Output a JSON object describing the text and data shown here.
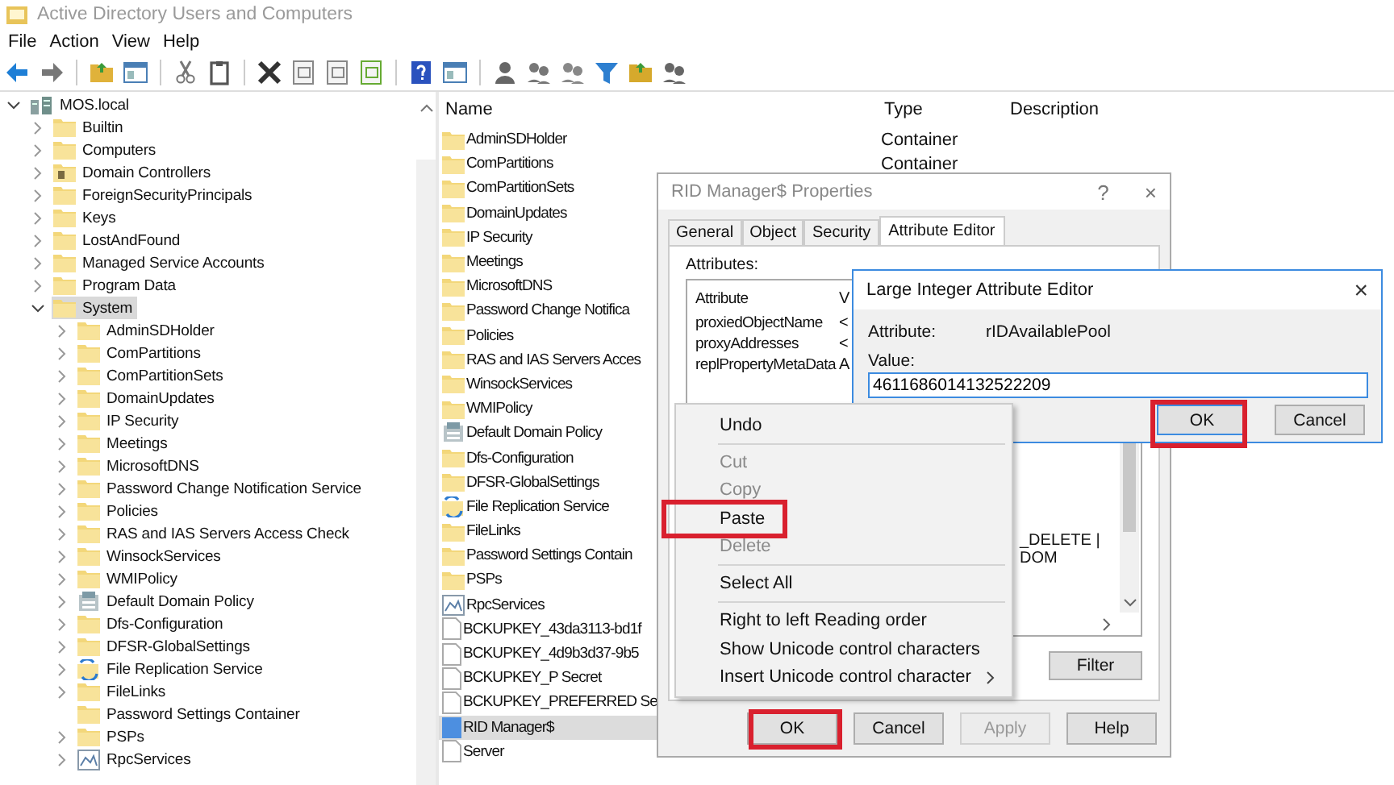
{
  "window": {
    "title": "Active Directory Users and Computers"
  },
  "menu": [
    "File",
    "Action",
    "View",
    "Help"
  ],
  "tree": [
    {
      "label": "MOS.local",
      "kind": "domain",
      "expandable": true,
      "expanded": true,
      "selected": false,
      "children": [
        {
          "label": "Builtin",
          "kind": "folder",
          "expandable": true,
          "expanded": false,
          "selected": false
        },
        {
          "label": "Computers",
          "kind": "folder",
          "expandable": true,
          "expanded": false,
          "selected": false
        },
        {
          "label": "Domain Controllers",
          "kind": "ou",
          "expandable": true,
          "expanded": false,
          "selected": false
        },
        {
          "label": "ForeignSecurityPrincipals",
          "kind": "folder",
          "expandable": true,
          "expanded": false,
          "selected": false
        },
        {
          "label": "Keys",
          "kind": "folder",
          "expandable": true,
          "expanded": false,
          "selected": false
        },
        {
          "label": "LostAndFound",
          "kind": "folder",
          "expandable": true,
          "expanded": false,
          "selected": false
        },
        {
          "label": "Managed Service Accounts",
          "kind": "folder",
          "expandable": true,
          "expanded": false,
          "selected": false
        },
        {
          "label": "Program Data",
          "kind": "folder",
          "expandable": true,
          "expanded": false,
          "selected": false
        },
        {
          "label": "System",
          "kind": "folder",
          "expandable": true,
          "expanded": true,
          "selected": true,
          "children": [
            {
              "label": "AdminSDHolder",
              "kind": "folder",
              "expandable": true,
              "expanded": false,
              "selected": false
            },
            {
              "label": "ComPartitions",
              "kind": "folder",
              "expandable": true,
              "expanded": false,
              "selected": false
            },
            {
              "label": "ComPartitionSets",
              "kind": "folder",
              "expandable": true,
              "expanded": false,
              "selected": false
            },
            {
              "label": "DomainUpdates",
              "kind": "folder",
              "expandable": true,
              "expanded": false,
              "selected": false
            },
            {
              "label": "IP Security",
              "kind": "folder",
              "expandable": true,
              "expanded": false,
              "selected": false
            },
            {
              "label": "Meetings",
              "kind": "folder",
              "expandable": true,
              "expanded": false,
              "selected": false
            },
            {
              "label": "MicrosoftDNS",
              "kind": "folder",
              "expandable": true,
              "expanded": false,
              "selected": false
            },
            {
              "label": "Password Change Notification Service",
              "kind": "folder",
              "expandable": true,
              "expanded": false,
              "selected": false
            },
            {
              "label": "Policies",
              "kind": "folder",
              "expandable": true,
              "expanded": false,
              "selected": false
            },
            {
              "label": "RAS and IAS Servers Access Check",
              "kind": "folder",
              "expandable": true,
              "expanded": false,
              "selected": false
            },
            {
              "label": "WinsockServices",
              "kind": "folder",
              "expandable": true,
              "expanded": false,
              "selected": false
            },
            {
              "label": "WMIPolicy",
              "kind": "folder",
              "expandable": true,
              "expanded": false,
              "selected": false
            },
            {
              "label": "Default Domain Policy",
              "kind": "policy",
              "expandable": true,
              "expanded": false,
              "selected": false
            },
            {
              "label": "Dfs-Configuration",
              "kind": "folder",
              "expandable": true,
              "expanded": false,
              "selected": false
            },
            {
              "label": "DFSR-GlobalSettings",
              "kind": "folder",
              "expandable": true,
              "expanded": false,
              "selected": false
            },
            {
              "label": "File Replication Service",
              "kind": "replication",
              "expandable": true,
              "expanded": false,
              "selected": false
            },
            {
              "label": "FileLinks",
              "kind": "folder",
              "expandable": true,
              "expanded": false,
              "selected": false
            },
            {
              "label": "Password Settings Container",
              "kind": "folder",
              "expandable": false,
              "selected": false
            },
            {
              "label": "PSPs",
              "kind": "folder",
              "expandable": true,
              "expanded": false,
              "selected": false
            },
            {
              "label": "RpcServices",
              "kind": "service",
              "expandable": true,
              "expanded": false,
              "selected": false
            }
          ]
        }
      ]
    }
  ],
  "list": {
    "columns": [
      "Name",
      "Type",
      "Description"
    ],
    "rows": [
      {
        "name": "AdminSDHolder",
        "kind": "folder",
        "type": "Container",
        "selected": false
      },
      {
        "name": "ComPartitions",
        "kind": "folder",
        "type": "Container",
        "selected": false
      },
      {
        "name": "ComPartitionSets",
        "kind": "folder",
        "selected": false
      },
      {
        "name": "DomainUpdates",
        "kind": "folder",
        "selected": false
      },
      {
        "name": "IP Security",
        "kind": "folder",
        "selected": false
      },
      {
        "name": "Meetings",
        "kind": "folder",
        "selected": false
      },
      {
        "name": "MicrosoftDNS",
        "kind": "folder",
        "selected": false
      },
      {
        "name": "Password Change Notifica",
        "kind": "folder",
        "selected": false
      },
      {
        "name": "Policies",
        "kind": "folder",
        "selected": false
      },
      {
        "name": "RAS and IAS Servers Acces",
        "kind": "folder",
        "selected": false
      },
      {
        "name": "WinsockServices",
        "kind": "folder",
        "selected": false
      },
      {
        "name": "WMIPolicy",
        "kind": "folder",
        "selected": false
      },
      {
        "name": "Default Domain Policy",
        "kind": "policy",
        "selected": false
      },
      {
        "name": "Dfs-Configuration",
        "kind": "folder",
        "selected": false
      },
      {
        "name": "DFSR-GlobalSettings",
        "kind": "folder",
        "selected": false
      },
      {
        "name": "File Replication Service",
        "kind": "replication",
        "selected": false
      },
      {
        "name": "FileLinks",
        "kind": "folder",
        "selected": false
      },
      {
        "name": "Password Settings Contain",
        "kind": "folder",
        "selected": false
      },
      {
        "name": "PSPs",
        "kind": "folder",
        "selected": false
      },
      {
        "name": "RpcServices",
        "kind": "service",
        "selected": false
      },
      {
        "name": "BCKUPKEY_43da3113-bd1f",
        "kind": "file",
        "selected": false
      },
      {
        "name": "BCKUPKEY_4d9b3d37-9b5",
        "kind": "file",
        "selected": false
      },
      {
        "name": "BCKUPKEY_P Secret",
        "kind": "file",
        "selected": false
      },
      {
        "name": "BCKUPKEY_PREFERRED Se",
        "kind": "file",
        "selected": false
      },
      {
        "name": "RID Manager$",
        "kind": "rid",
        "selected": true
      },
      {
        "name": "Server",
        "kind": "file",
        "selected": false
      }
    ]
  },
  "properties_dialog": {
    "title": "RID Manager$ Properties",
    "help_glyph": "?",
    "close_glyph": "×",
    "tabs": [
      {
        "label": "General",
        "selected": false
      },
      {
        "label": "Object",
        "selected": false
      },
      {
        "label": "Security",
        "selected": false
      },
      {
        "label": "Attribute Editor",
        "selected": true
      }
    ],
    "attributes_label": "Attributes:",
    "attribute_columns": [
      "Attribute",
      "V"
    ],
    "attribute_rows": [
      {
        "name": "proxiedObjectName",
        "value": "<"
      },
      {
        "name": "proxyAddresses",
        "value": "<"
      },
      {
        "name": "replPropertyMetaData",
        "value": "A"
      }
    ],
    "value_fragment": "_DELETE | DOM",
    "filter_button": "Filter",
    "buttons": [
      {
        "label": "OK",
        "disabled": false,
        "highlighted": true
      },
      {
        "label": "Cancel",
        "disabled": false,
        "highlighted": false
      },
      {
        "label": "Apply",
        "disabled": true,
        "highlighted": false
      },
      {
        "label": "Help",
        "disabled": false,
        "highlighted": false
      }
    ]
  },
  "integer_editor": {
    "title": "Large Integer Attribute Editor",
    "close_glyph": "×",
    "attribute_label": "Attribute:",
    "attribute_value": "rIDAvailablePool",
    "value_label": "Value:",
    "value": "4611686014132522209",
    "buttons": [
      {
        "label": "OK",
        "highlighted": true
      },
      {
        "label": "Cancel",
        "highlighted": false
      }
    ]
  },
  "context_menu": {
    "items": [
      {
        "kind": "item",
        "label": "Undo",
        "disabled": false,
        "highlighted": false,
        "submenu": false
      },
      {
        "kind": "separator"
      },
      {
        "kind": "item",
        "label": "Cut",
        "disabled": true,
        "highlighted": false,
        "submenu": false
      },
      {
        "kind": "item",
        "label": "Copy",
        "disabled": true,
        "highlighted": false,
        "submenu": false
      },
      {
        "kind": "item",
        "label": "Paste",
        "disabled": false,
        "highlighted": true,
        "submenu": false
      },
      {
        "kind": "item",
        "label": "Delete",
        "disabled": true,
        "highlighted": false,
        "submenu": false
      },
      {
        "kind": "separator"
      },
      {
        "kind": "item",
        "label": "Select All",
        "disabled": false,
        "highlighted": false,
        "submenu": false
      },
      {
        "kind": "separator"
      },
      {
        "kind": "item",
        "label": "Right to left Reading order",
        "disabled": false,
        "highlighted": false,
        "submenu": false
      },
      {
        "kind": "item",
        "label": "Show Unicode control characters",
        "disabled": false,
        "highlighted": false,
        "submenu": false
      },
      {
        "kind": "item",
        "label": "Insert Unicode control character",
        "disabled": false,
        "highlighted": false,
        "submenu": true
      }
    ]
  }
}
